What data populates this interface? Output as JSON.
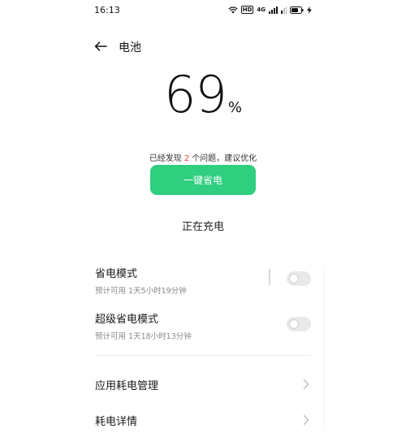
{
  "status_bar": {
    "time": "16:13",
    "network_tag": "HD",
    "signal_tag": "4G",
    "icons": [
      "wifi-icon",
      "hd-icon",
      "signal-icon",
      "signal-secondary-icon",
      "battery-icon",
      "charging-bolt-icon"
    ]
  },
  "header": {
    "title": "电池",
    "back_icon": "back-arrow-icon"
  },
  "battery": {
    "percent": "69",
    "percent_symbol": "%"
  },
  "issues": {
    "prefix": "已经发现",
    "count": "2",
    "suffix": "个问题，建议优化",
    "count_color": "#e53935"
  },
  "optimize_button": {
    "label": "一键省电",
    "color": "#2fcf7f"
  },
  "charging_status": "正在充电",
  "settings": [
    {
      "title": "省电模式",
      "subtitle": "预计可用 1天5小时19分钟",
      "toggle_on": false
    },
    {
      "title": "超级省电模式",
      "subtitle": "预计可用 1天18小时13分钟",
      "toggle_on": false
    }
  ],
  "nav_items": [
    {
      "label": "应用耗电管理",
      "icon": "chevron-right-icon"
    },
    {
      "label": "耗电详情",
      "icon": "chevron-right-icon"
    }
  ]
}
